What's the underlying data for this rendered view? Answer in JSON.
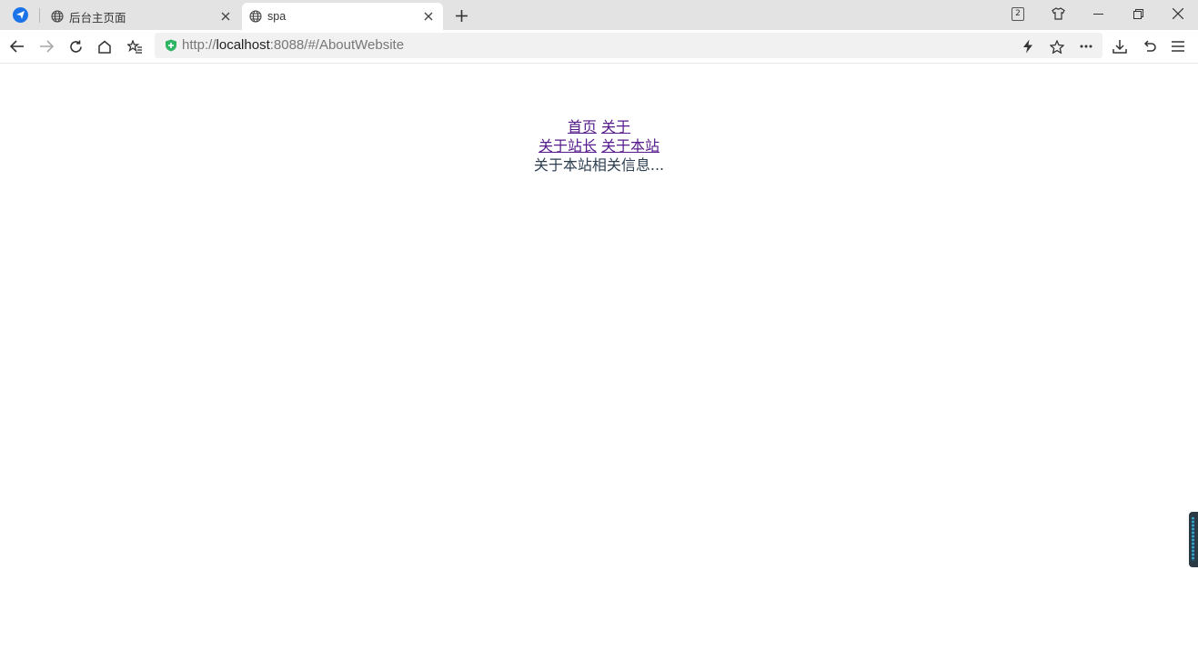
{
  "browser": {
    "tabs": [
      {
        "title": "后台主页面",
        "active": false
      },
      {
        "title": "spa",
        "active": true
      }
    ],
    "tab_count": "2",
    "address": {
      "scheme": "http://",
      "host": "localhost",
      "rest": ":8088/#/AboutWebsite"
    },
    "colors": {
      "tabstrip": "#e3e3e3",
      "address_bar": "#f1f1f1",
      "secure": "#2fb463",
      "extension": "#1a73e8"
    }
  },
  "page": {
    "nav": [
      {
        "label": "首页"
      },
      {
        "label": "关于"
      }
    ],
    "subnav": [
      {
        "label": "关于站长"
      },
      {
        "label": "关于本站"
      }
    ],
    "content_text": "关于本站相关信息...",
    "colors": {
      "link": "#551a8b",
      "text": "#2c3e50"
    }
  }
}
